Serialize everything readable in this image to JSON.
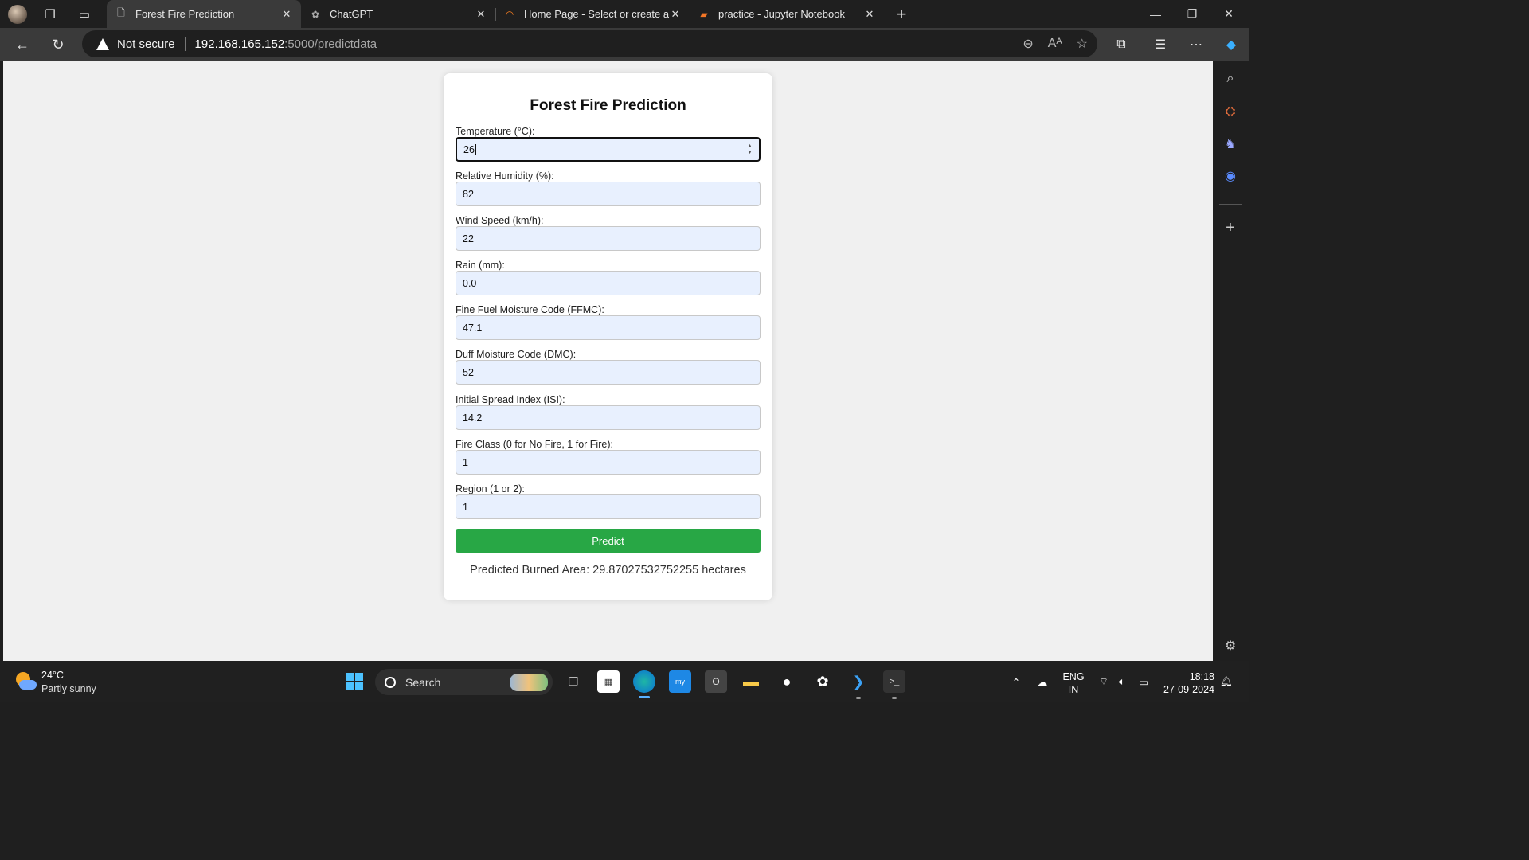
{
  "browser": {
    "tabs": [
      {
        "title": "Forest Fire Prediction",
        "active": true
      },
      {
        "title": "ChatGPT",
        "active": false
      },
      {
        "title": "Home Page - Select or create a no",
        "active": false
      },
      {
        "title": "practice - Jupyter Notebook",
        "active": false
      }
    ],
    "security_text": "Not secure",
    "url_host": "192.168.165.152",
    "url_path": ":5000/predictdata",
    "icons": [
      "back-icon",
      "refresh-icon",
      "zoom-out-icon",
      "read-aloud-icon",
      "favorite-star-icon",
      "extensions-icon",
      "favorites-icon",
      "more-icon",
      "copilot-icon"
    ]
  },
  "form": {
    "title": "Forest Fire Prediction",
    "fields": [
      {
        "label": "Temperature (°C):",
        "value": "26"
      },
      {
        "label": "Relative Humidity (%):",
        "value": "82"
      },
      {
        "label": "Wind Speed (km/h):",
        "value": "22"
      },
      {
        "label": "Rain (mm):",
        "value": "0.0"
      },
      {
        "label": "Fine Fuel Moisture Code (FFMC):",
        "value": "47.1"
      },
      {
        "label": "Duff Moisture Code (DMC):",
        "value": "52"
      },
      {
        "label": "Initial Spread Index (ISI):",
        "value": "14.2"
      },
      {
        "label": "Fire Class (0 for No Fire, 1 for Fire):",
        "value": "1"
      },
      {
        "label": "Region (1 or 2):",
        "value": "1"
      }
    ],
    "button_label": "Predict",
    "result_text": "Predicted Burned Area: 29.87027532752255 hectares",
    "button_color": "#28a745",
    "input_bg": "#e8f0fe"
  },
  "taskbar": {
    "weather_temp": "24°C",
    "weather_desc": "Partly sunny",
    "search_label": "Search",
    "lang_line1": "ENG",
    "lang_line2": "IN",
    "time": "18:18",
    "date": "27-09-2024"
  }
}
